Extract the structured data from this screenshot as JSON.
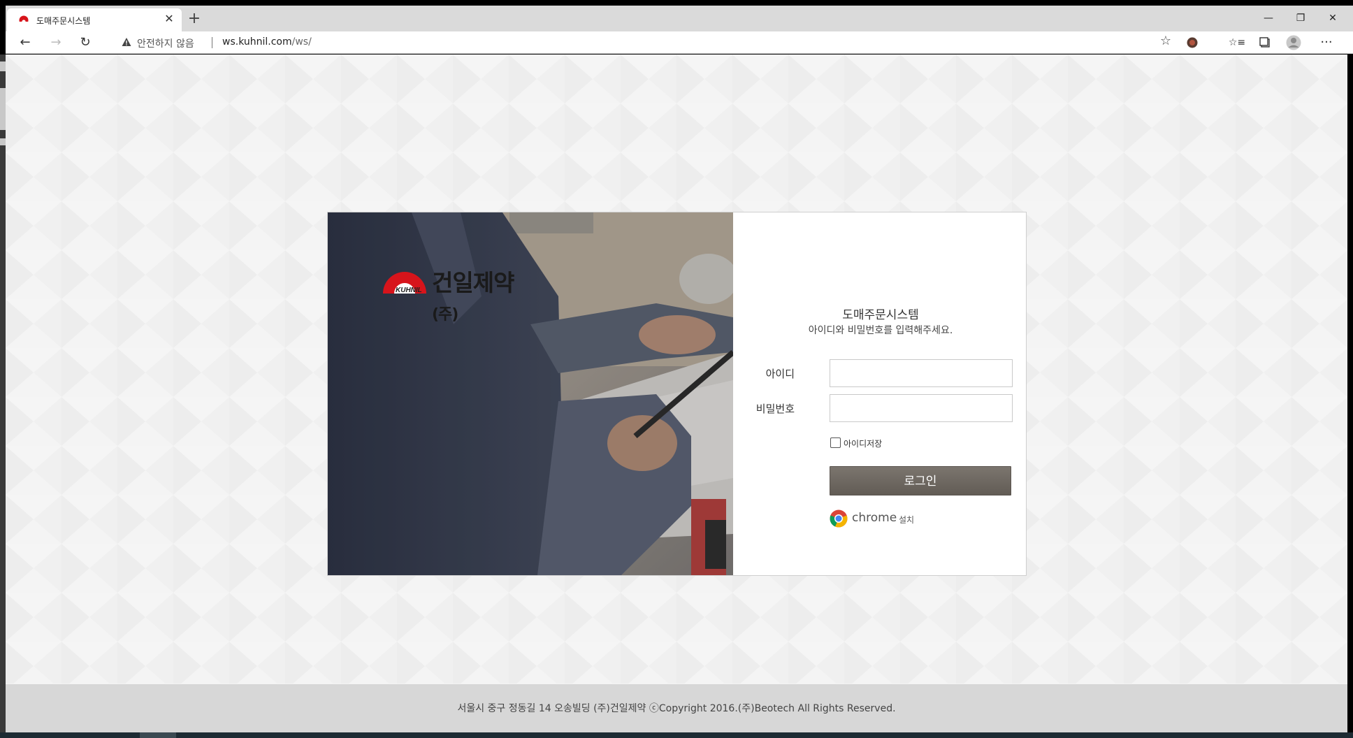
{
  "browser": {
    "tab_title": "도매주문시스템",
    "tab_close": "✕",
    "new_tab": "+",
    "window_controls": {
      "minimize": "—",
      "restore": "❐",
      "close": "✕"
    },
    "security_label": "안전하지 않음",
    "url_host": "ws.kuhnil.com",
    "url_path": "/ws/",
    "nav": {
      "back": "←",
      "forward": "→",
      "reload": "↻",
      "favorite": "☆",
      "favorites_list": "☆≡",
      "more": "···"
    }
  },
  "login": {
    "company_name": "건일제약",
    "company_suffix": "(주)",
    "logo_mark_text": "KUHNIL",
    "system_title": "도매주문시스템",
    "instruction": "아이디와 비밀번호를 입력해주세요.",
    "id_label": "아이디",
    "password_label": "비밀번호",
    "remember_id_label": "아이디저장",
    "login_button": "로그인",
    "chrome_label": "chrome",
    "chrome_install": "설치"
  },
  "footer": {
    "text": "서울시 중구 정동길 14 오송빌딩 (주)건일제약 ⓒCopyright 2016.(주)Beotech All Rights Reserved."
  },
  "colors": {
    "brand_red": "#d7141b",
    "button_gray": "#6e6862",
    "page_bg": "#f4f4f4",
    "footer_bg": "#d7d7d7"
  }
}
